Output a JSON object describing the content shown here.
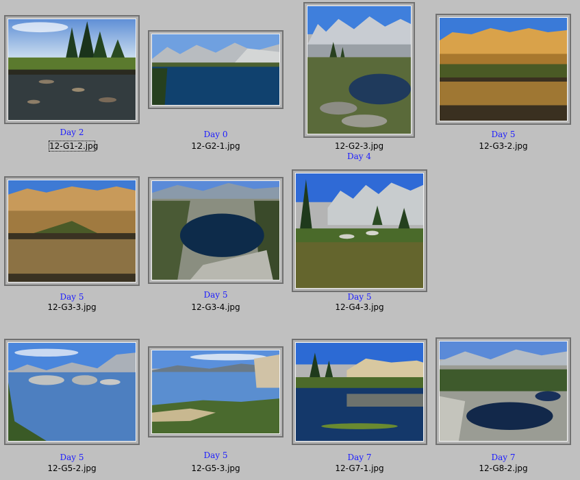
{
  "thumbnails": [
    {
      "day_label": "Day 2",
      "filename": "12-G1-2.jpg",
      "selected": true
    },
    {
      "day_label": "Day 0",
      "filename": "12-G2-1.jpg",
      "selected": false
    },
    {
      "day_label": "Day 4",
      "filename": "12-G2-3.jpg",
      "selected": false
    },
    {
      "day_label": "Day 5",
      "filename": "12-G3-2.jpg",
      "selected": false
    },
    {
      "day_label": "Day 5",
      "filename": "12-G3-3.jpg",
      "selected": false
    },
    {
      "day_label": "Day 5",
      "filename": "12-G3-4.jpg",
      "selected": false
    },
    {
      "day_label": "Day 5",
      "filename": "12-G4-3.jpg",
      "selected": false
    },
    {
      "day_label": "Day 5",
      "filename": "12-G5-2.jpg",
      "selected": false
    },
    {
      "day_label": "Day 5",
      "filename": "12-G5-3.jpg",
      "selected": false
    },
    {
      "day_label": "Day 7",
      "filename": "12-G7-1.jpg",
      "selected": false
    },
    {
      "day_label": "Day 7",
      "filename": "12-G8-2.jpg",
      "selected": false
    }
  ],
  "colors": {
    "background": "#c0c0c0",
    "day_link": "#1a1aff",
    "filename_text": "#000000"
  }
}
